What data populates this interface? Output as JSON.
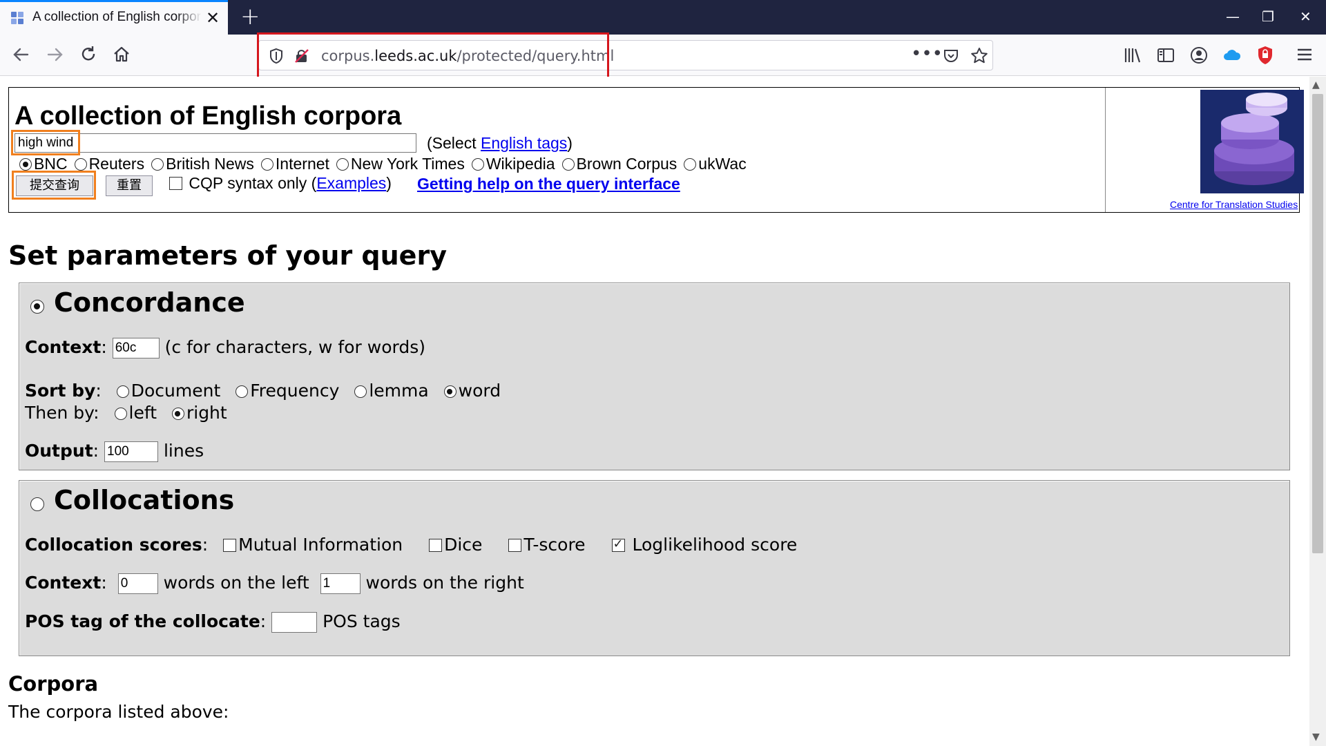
{
  "browser": {
    "tab_title": "A collection of English corpora",
    "tab_close": "✕",
    "new_tab": "+",
    "url_domain_prefix": "corpus.",
    "url_domain": "leeds.ac.uk",
    "url_path": "/protected/query.html",
    "window_controls": [
      "—",
      "❐",
      "✕"
    ],
    "nav_icons": [
      "back-icon",
      "forward-icon",
      "reload-icon",
      "home-icon"
    ],
    "toolbar_icons": [
      "library-icon",
      "sidebar-icon",
      "account-icon",
      "cloud-icon",
      "shield-extension-icon",
      "menu-icon"
    ]
  },
  "header": {
    "title": "A collection of English corpora",
    "query_value": "high wind",
    "select_prefix": "(Select ",
    "select_link": "English tags",
    "select_suffix": ")",
    "corpora": [
      {
        "label": "BNC",
        "checked": true
      },
      {
        "label": "Reuters",
        "checked": false
      },
      {
        "label": "British News",
        "checked": false
      },
      {
        "label": "Internet",
        "checked": false
      },
      {
        "label": "New York Times",
        "checked": false
      },
      {
        "label": "Wikipedia",
        "checked": false
      },
      {
        "label": "Brown Corpus",
        "checked": false
      },
      {
        "label": "ukWac",
        "checked": false
      }
    ],
    "submit_label": "提交查询",
    "reset_label": "重置",
    "cqp_label": "CQP syntax only (",
    "examples_link": "Examples",
    "cqp_suffix": ")",
    "help_link": "Getting help on the query interface",
    "cts_link": "Centre for Translation Studies"
  },
  "params_title": "Set parameters of your query",
  "concordance": {
    "title": "Concordance",
    "selected": true,
    "context_label": "Context",
    "context_value": "60c",
    "context_hint": "(c for characters, w for words)",
    "sort_label": "Sort by",
    "sort_options": [
      {
        "label": "Document",
        "checked": false
      },
      {
        "label": "Frequency",
        "checked": false
      },
      {
        "label": "lemma",
        "checked": false
      },
      {
        "label": "word",
        "checked": true
      }
    ],
    "then_label": "Then by:",
    "then_options": [
      {
        "label": "left",
        "checked": false
      },
      {
        "label": "right",
        "checked": true
      }
    ],
    "output_label": "Output",
    "output_value": "100",
    "output_suffix": "lines"
  },
  "collocations": {
    "title": "Collocations",
    "selected": false,
    "scores_label": "Collocation scores",
    "scores": [
      {
        "label": "Mutual Information",
        "checked": false
      },
      {
        "label": "Dice",
        "checked": false
      },
      {
        "label": "T-score",
        "checked": false
      },
      {
        "label": "Loglikelihood score",
        "checked": true
      }
    ],
    "context_label": "Context",
    "left_value": "0",
    "left_suffix": "words on the left",
    "right_value": "1",
    "right_suffix": "words on the right",
    "pos_label": "POS tag of the collocate",
    "pos_value": "",
    "pos_suffix": "POS tags"
  },
  "corpora_section": {
    "title": "Corpora",
    "text": "The corpora listed above:"
  },
  "colors": {
    "tabbar": "#1f2440",
    "accent": "#0a84ff",
    "url_highlight": "#d5161d",
    "annotation": "#f07f1e",
    "link": "#0000ee",
    "panel": "#dcdcdc"
  }
}
